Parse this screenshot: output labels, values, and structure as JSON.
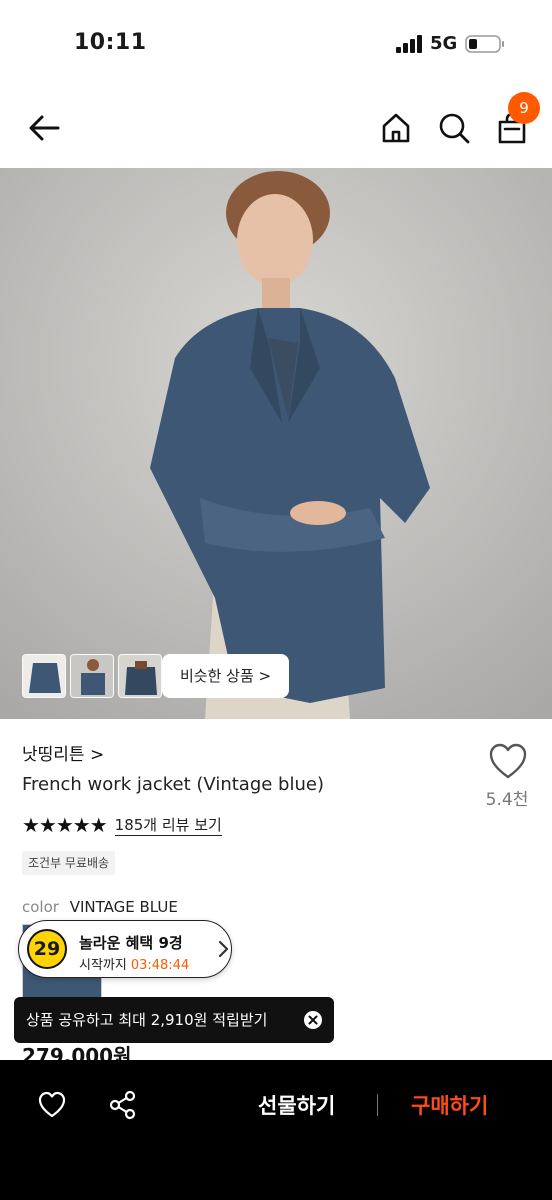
{
  "status_bar": {
    "time": "10:11",
    "network": "5G"
  },
  "nav": {
    "cart_count": "9"
  },
  "hero": {
    "similar_label": "비슷한 상품 >"
  },
  "product": {
    "brand": "낫띵리튼 >",
    "title": "French work jacket (Vintage blue)",
    "wish_count": "5.4천",
    "stars": "★★★★★",
    "review_link": "185개 리뷰 보기",
    "shipping_tag": "조건부 무료배송",
    "color_label": "color",
    "color_value": "VINTAGE BLUE",
    "price": "279,000원"
  },
  "promo": {
    "badge": "29",
    "title": "놀라운 혜택 9경",
    "sub_label": "시작까지",
    "timer": "03:48:44"
  },
  "toast": {
    "message": "상품 공유하고 최대 2,910원 적립받기"
  },
  "bottom_bar": {
    "gift_label": "선물하기",
    "buy_label": "구매하기"
  },
  "colors": {
    "accent": "#ff5a00",
    "buy": "#ff4a1a",
    "jacket": "#3e5775"
  }
}
